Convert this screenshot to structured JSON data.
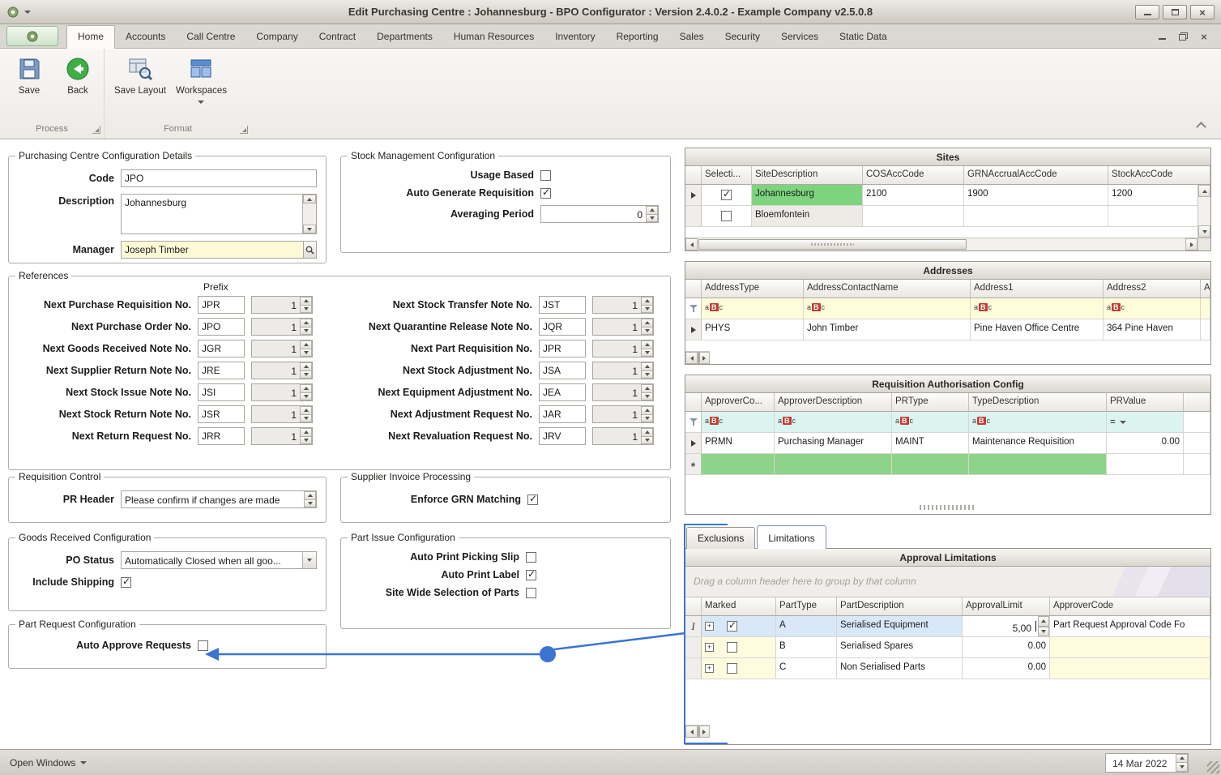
{
  "window": {
    "title": "Edit Purchasing Centre : Johannesburg - BPO Configurator : Version 2.4.0.2 - Example Company v2.5.0.8"
  },
  "ribbon": {
    "tabs": [
      "Home",
      "Accounts",
      "Call Centre",
      "Company",
      "Contract",
      "Departments",
      "Human Resources",
      "Inventory",
      "Reporting",
      "Sales",
      "Security",
      "Services",
      "Static Data"
    ],
    "save": "Save",
    "back": "Back",
    "save_layout": "Save Layout",
    "workspaces": "Workspaces",
    "group_process": "Process",
    "group_format": "Format"
  },
  "form": {
    "pccd": {
      "title": "Purchasing Centre Configuration Details",
      "code_label": "Code",
      "code": "JPO",
      "description_label": "Description",
      "description": "Johannesburg",
      "manager_label": "Manager",
      "manager": "Joseph Timber"
    },
    "stock": {
      "title": "Stock Management Configuration",
      "usage_based_label": "Usage Based",
      "usage_based": false,
      "auto_gen_label": "Auto Generate Requisition",
      "auto_gen": true,
      "avg_label": "Averaging Period",
      "avg_value": "0"
    },
    "references": {
      "title": "References",
      "prefix_header": "Prefix",
      "left": [
        {
          "label": "Next Purchase Requisition No.",
          "prefix": "JPR",
          "value": "1"
        },
        {
          "label": "Next Purchase Order No.",
          "prefix": "JPO",
          "value": "1"
        },
        {
          "label": "Next Goods Received Note No.",
          "prefix": "JGR",
          "value": "1"
        },
        {
          "label": "Next Supplier Return Note No.",
          "prefix": "JRE",
          "value": "1"
        },
        {
          "label": "Next Stock Issue Note No.",
          "prefix": "JSI",
          "value": "1"
        },
        {
          "label": "Next Stock Return Note No.",
          "prefix": "JSR",
          "value": "1"
        },
        {
          "label": "Next Return Request No.",
          "prefix": "JRR",
          "value": "1"
        }
      ],
      "right": [
        {
          "label": "Next Stock Transfer Note No.",
          "prefix": "JST",
          "value": "1"
        },
        {
          "label": "Next Quarantine Release Note No.",
          "prefix": "JQR",
          "value": "1"
        },
        {
          "label": "Next Part Requisition No.",
          "prefix": "JPR",
          "value": "1"
        },
        {
          "label": "Next Stock Adjustment No.",
          "prefix": "JSA",
          "value": "1"
        },
        {
          "label": "Next Equipment Adjustment No.",
          "prefix": "JEA",
          "value": "1"
        },
        {
          "label": "Next Adjustment Request No.",
          "prefix": "JAR",
          "value": "1"
        },
        {
          "label": "Next Revaluation Request No.",
          "prefix": "JRV",
          "value": "1"
        }
      ]
    },
    "req_control": {
      "title": "Requisition Control",
      "pr_header_label": "PR Header",
      "pr_header": "Please confirm if changes are made"
    },
    "sip": {
      "title": "Supplier Invoice Processing",
      "enforce_label": "Enforce GRN Matching",
      "enforce": true
    },
    "grc": {
      "title": "Goods Received Configuration",
      "po_status_label": "PO Status",
      "po_status": "Automatically Closed when all goo...",
      "include_shipping_label": "Include Shipping",
      "include_shipping": true
    },
    "pic": {
      "title": "Part Issue Configuration",
      "picking_label": "Auto Print Picking Slip",
      "picking": false,
      "label_label": "Auto Print Label",
      "print_label": true,
      "sitewide_label": "Site Wide Selection of Parts",
      "sitewide": false
    },
    "prc": {
      "title": "Part Request Configuration",
      "auto_approve_label": "Auto Approve Requests",
      "auto_approve": false
    }
  },
  "sites": {
    "title": "Sites",
    "columns": [
      "Selecti...",
      "SiteDescription",
      "COSAccCode",
      "GRNAccrualAccCode",
      "StockAccCode"
    ],
    "rows": [
      {
        "checked": true,
        "site": "Johannesburg",
        "cos": "2100",
        "grn": "1900",
        "stock": "1200"
      },
      {
        "checked": false,
        "site": "Bloemfontein",
        "cos": "",
        "grn": "",
        "stock": ""
      }
    ]
  },
  "addresses": {
    "title": "Addresses",
    "columns": [
      "AddressType",
      "AddressContactName",
      "Address1",
      "Address2",
      "Ad"
    ],
    "rows": [
      {
        "type": "PHYS",
        "contact": "John Timber",
        "a1": "Pine Haven Office Centre",
        "a2": "364 Pine Haven"
      }
    ]
  },
  "req_auth": {
    "title": "Requisition Authorisation Config",
    "columns": [
      "ApproverCo...",
      "ApproverDescription",
      "PRType",
      "TypeDescription",
      "PRValue"
    ],
    "filter_eq": "=",
    "rows": [
      {
        "code": "PRMN",
        "desc": "Purchasing Manager",
        "type": "MAINT",
        "typedesc": "Maintenance Requisition",
        "value": "0.00"
      }
    ]
  },
  "limitations": {
    "tab_exclusions": "Exclusions",
    "tab_limitations": "Limitations",
    "title": "Approval Limitations",
    "group_hint": "Drag a column header here to group by that column",
    "columns": [
      "Marked",
      "PartType",
      "PartDescription",
      "ApprovalLimit",
      "ApproverCode"
    ],
    "rows": [
      {
        "marked": true,
        "type": "A",
        "desc": "Serialised Equipment",
        "limit": "5,00",
        "approver": "Part Request Approval Code Fo"
      },
      {
        "marked": false,
        "type": "B",
        "desc": "Serialised Spares",
        "limit": "0.00",
        "approver": ""
      },
      {
        "marked": false,
        "type": "C",
        "desc": "Non Serialised Parts",
        "limit": "0.00",
        "approver": ""
      }
    ]
  },
  "statusbar": {
    "open_windows": "Open Windows",
    "date": "14 Mar 2022"
  },
  "icons": {
    "abc_a": "a",
    "abc_b": "B",
    "abc_c": "c"
  },
  "colors": {
    "accent_blue": "#3b74d1",
    "row_green": "#7ed47e",
    "filter_yellow": "#fffcda",
    "filter_cyan": "#dcf4f0"
  }
}
